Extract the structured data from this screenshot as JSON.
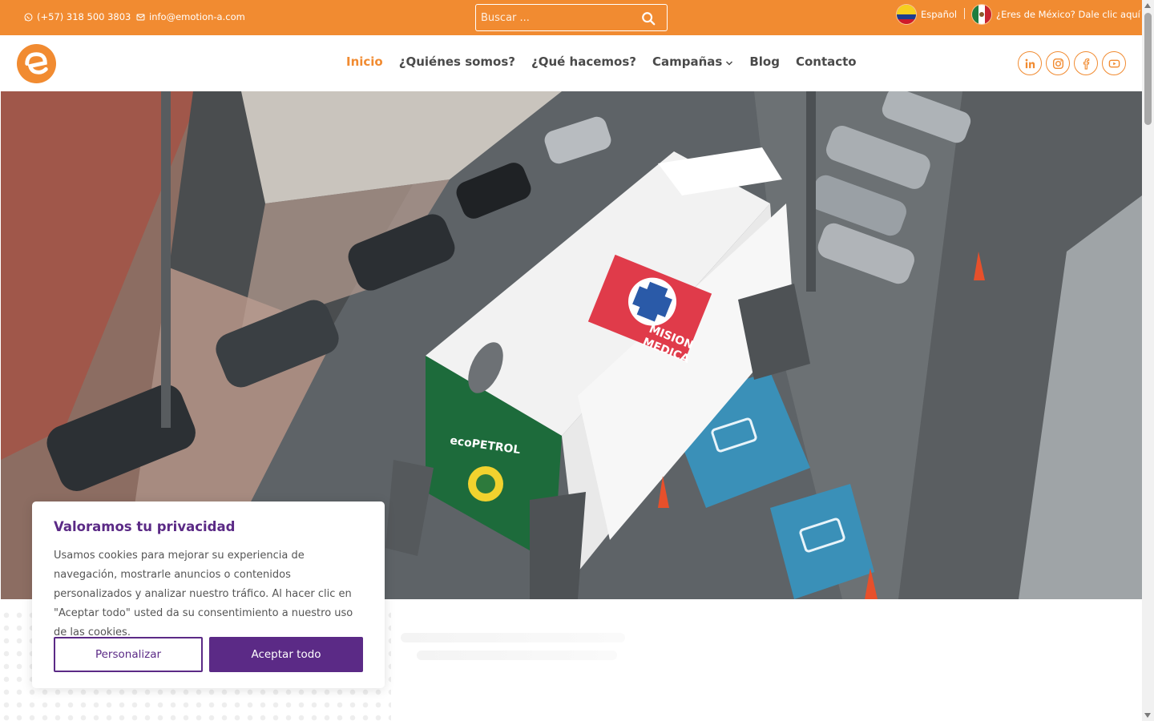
{
  "topbar": {
    "phone": "(+57) 318 500 3803",
    "email": "info@emotion-a.com",
    "search_placeholder": "Buscar ...",
    "lang_es": "Español",
    "lang_mx": "¿Eres de México? Dale clic aquí"
  },
  "header": {
    "nav": [
      {
        "label": "Inicio",
        "active": true
      },
      {
        "label": "¿Quiénes somos?"
      },
      {
        "label": "¿Qué hacemos?"
      },
      {
        "label": "Campañas"
      },
      {
        "label": "Blog"
      },
      {
        "label": "Contacto"
      }
    ],
    "social": [
      "linkedin-icon",
      "instagram-icon",
      "facebook-icon",
      "youtube-icon"
    ]
  },
  "hero": {
    "sign_line1": "MISION",
    "sign_line2": "MEDICA",
    "ecopetrol": "ecoPETROL"
  },
  "cookie": {
    "title": "Valoramos tu privacidad",
    "text": "Usamos cookies para mejorar su experiencia de navegación, mostrarle anuncios o contenidos personalizados y analizar nuestro tráfico. Al hacer clic en \"Aceptar todo\" usted da su consentimiento a nuestro uso de las cookies.",
    "customize": "Personalizar",
    "accept": "Aceptar todo"
  },
  "colors": {
    "brand_orange": "#f18b31",
    "brand_purple": "#5b2a86"
  }
}
